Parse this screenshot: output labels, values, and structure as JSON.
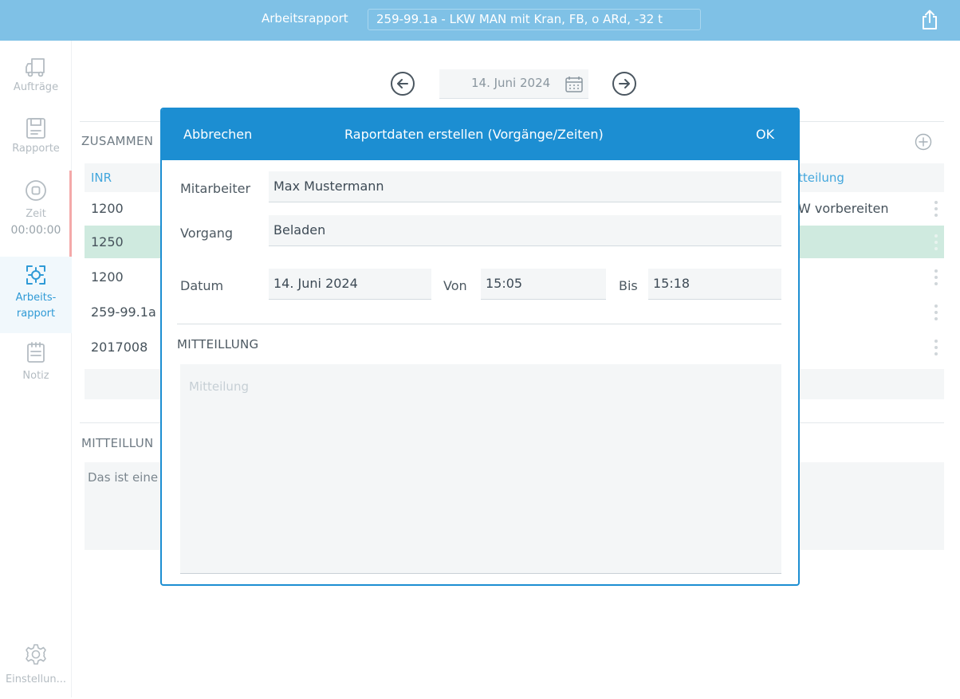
{
  "header": {
    "title": "Arbeitsrapport",
    "order": "259-99.1a - LKW MAN mit Kran, FB, o ARd, -32 t",
    "share_icon": "share-icon"
  },
  "sidebar": {
    "items": [
      {
        "label": "Aufträge",
        "icon": "truck-icon"
      },
      {
        "label": "Rapporte",
        "icon": "save-icon"
      },
      {
        "label": "Zeit",
        "icon": "stop-icon",
        "value": "00:00:00"
      },
      {
        "label": "Arbeits-",
        "label2": "rapport",
        "icon": "scan-icon"
      },
      {
        "label": "Notiz",
        "icon": "note-icon"
      }
    ],
    "settings_label": "Einstellun...",
    "settings_icon": "gear-icon"
  },
  "main": {
    "date": "14. Juni 2024",
    "summary_title": "ZUSAMMEN",
    "columns": {
      "inr": "INR",
      "mitteilung": "tteilung"
    },
    "rows": [
      {
        "inr": "1200",
        "mitteilung": "W vorbereiten"
      },
      {
        "inr": "1250",
        "mitteilung": ""
      },
      {
        "inr": "1200",
        "mitteilung": ""
      },
      {
        "inr": "259-99.1a",
        "mitteilung": ""
      },
      {
        "inr": "2017008",
        "mitteilung": ""
      }
    ],
    "message_title": "MITTEILLUN",
    "message_text": "Das ist eine"
  },
  "modal": {
    "cancel": "Abbrechen",
    "title": "Raportdaten erstellen (Vorgänge/Zeiten)",
    "ok": "OK",
    "mitarbeiter_label": "Mitarbeiter",
    "mitarbeiter_value": "Max Mustermann",
    "vorgang_label": "Vorgang",
    "vorgang_value": "Beladen",
    "datum_label": "Datum",
    "datum_value": "14. Juni 2024",
    "von_label": "Von",
    "von_value": "15:05",
    "bis_label": "Bis",
    "bis_value": "15:18",
    "mitteilung_title": "MITTEILLUNG",
    "mitteilung_placeholder": "Mitteilung"
  },
  "colors": {
    "header_bg": "#7fc1e6",
    "modal_accent": "#1c8ed2",
    "link_blue": "#43a7dd",
    "selected_row": "#cfeadf",
    "timer_indicator": "#f4a9a9"
  }
}
